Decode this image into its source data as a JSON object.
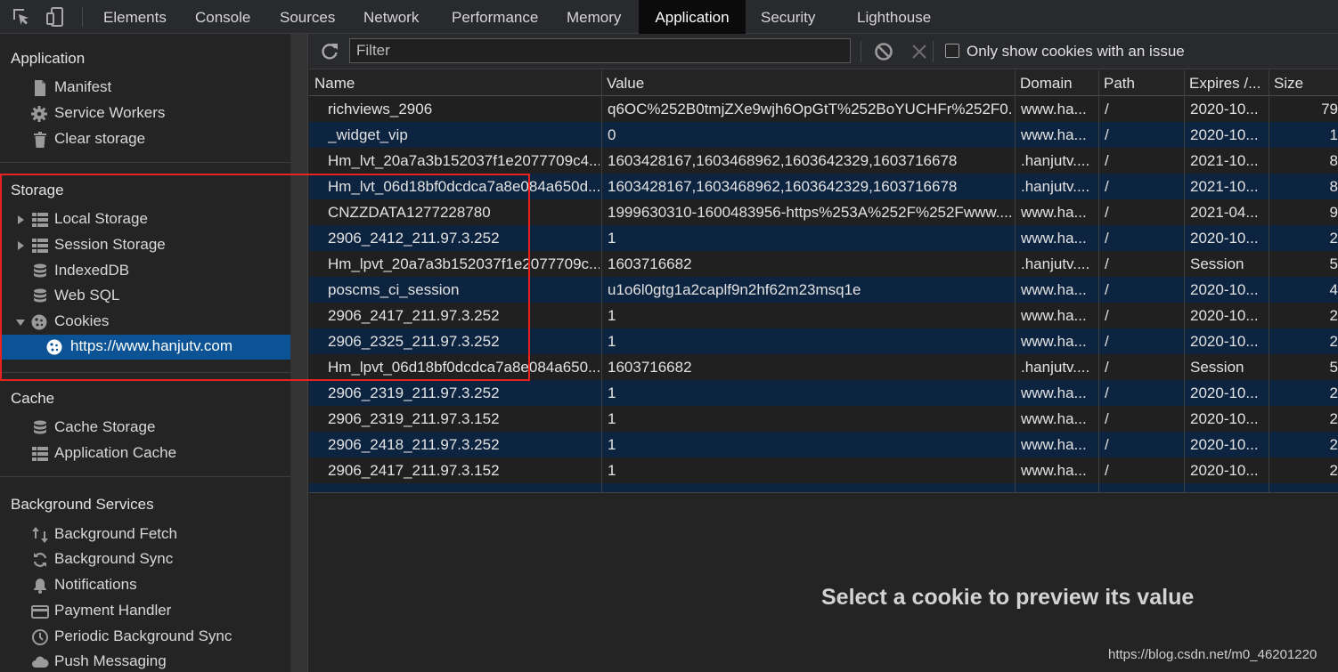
{
  "tabs": [
    "Elements",
    "Console",
    "Sources",
    "Network",
    "Performance",
    "Memory",
    "Application",
    "Security",
    "Lighthouse"
  ],
  "active_tab": "Application",
  "sidebar": {
    "application": {
      "title": "Application",
      "items": [
        "Manifest",
        "Service Workers",
        "Clear storage"
      ]
    },
    "storage": {
      "title": "Storage",
      "items": [
        "Local Storage",
        "Session Storage",
        "IndexedDB",
        "Web SQL",
        "Cookies"
      ],
      "cookie_origin": "https://www.hanjutv.com"
    },
    "cache": {
      "title": "Cache",
      "items": [
        "Cache Storage",
        "Application Cache"
      ]
    },
    "background": {
      "title": "Background Services",
      "items": [
        "Background Fetch",
        "Background Sync",
        "Notifications",
        "Payment Handler",
        "Periodic Background Sync",
        "Push Messaging"
      ]
    }
  },
  "toolbar": {
    "filter_placeholder": "Filter",
    "only_issue_label": "Only show cookies with an issue",
    "only_issue_checked": false
  },
  "table": {
    "columns": [
      "Name",
      "Value",
      "Domain",
      "Path",
      "Expires /...",
      "Size"
    ],
    "rows": [
      {
        "name": "richviews_2906",
        "value": "q6OC%252B0tmjZXe9wjh6OpGtT%252BoYUCHFr%252F0...",
        "domain": "www.ha...",
        "path": "/",
        "expires": "2020-10...",
        "size": "79"
      },
      {
        "name": "_widget_vip",
        "value": "0",
        "domain": "www.ha...",
        "path": "/",
        "expires": "2020-10...",
        "size": "1"
      },
      {
        "name": "Hm_lvt_20a7a3b152037f1e2077709c4...",
        "value": "1603428167,1603468962,1603642329,1603716678",
        "domain": ".hanjutv....",
        "path": "/",
        "expires": "2021-10...",
        "size": "8"
      },
      {
        "name": "Hm_lvt_06d18bf0dcdca7a8e084a650d...",
        "value": "1603428167,1603468962,1603642329,1603716678",
        "domain": ".hanjutv....",
        "path": "/",
        "expires": "2021-10...",
        "size": "8"
      },
      {
        "name": "CNZZDATA1277228780",
        "value": "1999630310-1600483956-https%253A%252F%252Fwww....",
        "domain": "www.ha...",
        "path": "/",
        "expires": "2021-04...",
        "size": "9"
      },
      {
        "name": "2906_2412_211.97.3.252",
        "value": "1",
        "domain": "www.ha...",
        "path": "/",
        "expires": "2020-10...",
        "size": "2"
      },
      {
        "name": "Hm_lpvt_20a7a3b152037f1e2077709c...",
        "value": "1603716682",
        "domain": ".hanjutv....",
        "path": "/",
        "expires": "Session",
        "size": "5"
      },
      {
        "name": "poscms_ci_session",
        "value": "u1o6l0gtg1a2caplf9n2hf62m23msq1e",
        "domain": "www.ha...",
        "path": "/",
        "expires": "2020-10...",
        "size": "4"
      },
      {
        "name": "2906_2417_211.97.3.252",
        "value": "1",
        "domain": "www.ha...",
        "path": "/",
        "expires": "2020-10...",
        "size": "2"
      },
      {
        "name": "2906_2325_211.97.3.252",
        "value": "1",
        "domain": "www.ha...",
        "path": "/",
        "expires": "2020-10...",
        "size": "2"
      },
      {
        "name": "Hm_lpvt_06d18bf0dcdca7a8e084a650...",
        "value": "1603716682",
        "domain": ".hanjutv....",
        "path": "/",
        "expires": "Session",
        "size": "5"
      },
      {
        "name": "2906_2319_211.97.3.252",
        "value": "1",
        "domain": "www.ha...",
        "path": "/",
        "expires": "2020-10...",
        "size": "2"
      },
      {
        "name": "2906_2319_211.97.3.152",
        "value": "1",
        "domain": "www.ha...",
        "path": "/",
        "expires": "2020-10...",
        "size": "2"
      },
      {
        "name": "2906_2418_211.97.3.252",
        "value": "1",
        "domain": "www.ha...",
        "path": "/",
        "expires": "2020-10...",
        "size": "2"
      },
      {
        "name": "2906_2417_211.97.3.152",
        "value": "1",
        "domain": "www.ha...",
        "path": "/",
        "expires": "2020-10...",
        "size": "2"
      }
    ]
  },
  "preview": {
    "message": "Select a cookie to preview its value"
  },
  "watermark": "https://blog.csdn.net/m0_46201220",
  "colors": {
    "selected_row": "#0b5394",
    "highlight_box": "#e8231f",
    "even_row": "#0d2440"
  }
}
